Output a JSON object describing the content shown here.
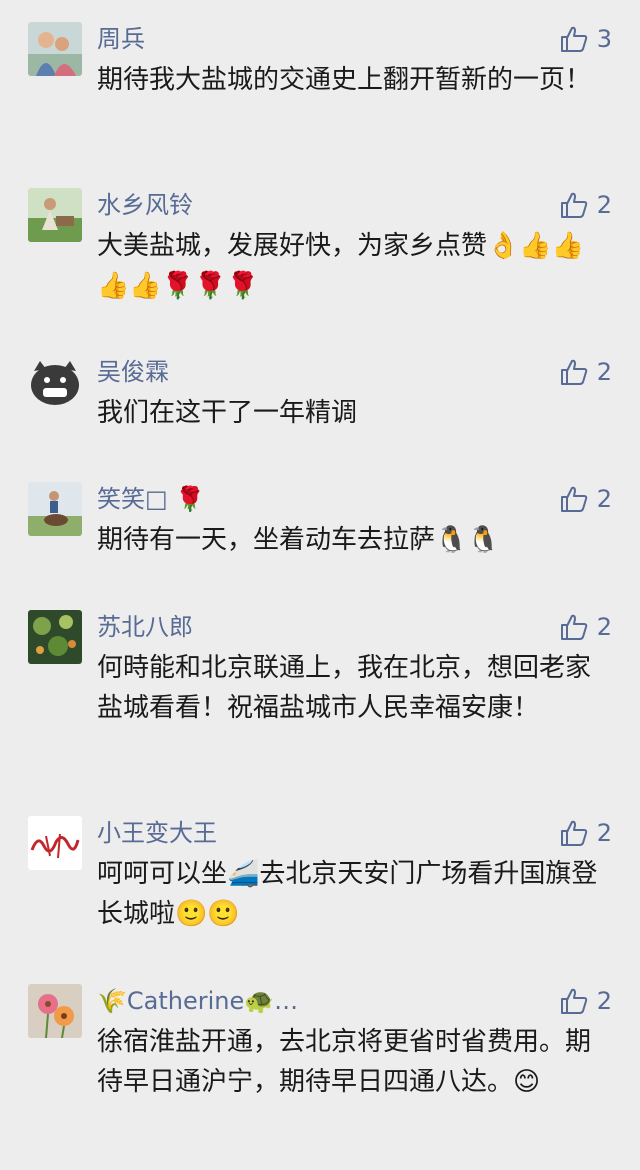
{
  "comments": [
    {
      "name": "周兵",
      "text": "期待我大盐城的交通史上翻开暂新的一页！",
      "likes": "3",
      "avatar": "avatar-photo-family"
    },
    {
      "name": "水乡风铃",
      "text": "大美盐城，发展好快，为家乡点赞👌👍👍👍👍🌹🌹🌹",
      "likes": "2",
      "avatar": "avatar-photo-field"
    },
    {
      "name": "吴俊霖",
      "text": "我们在这干了一年精调",
      "likes": "2",
      "avatar": "avatar-cartoon-pig"
    },
    {
      "name": "笑笑□ 🌹",
      "text": "期待有一天，坐着动车去拉萨🐧🐧",
      "likes": "2",
      "avatar": "avatar-photo-rider"
    },
    {
      "name": "苏北八郎",
      "text": "何時能和北京联通上，我在北京，想回老家盐城看看！祝福盐城市人民幸福安康！",
      "likes": "2",
      "avatar": "avatar-photo-flowers"
    },
    {
      "name": "小王变大王",
      "text": "呵呵可以坐🚄去北京天安门广场看升国旗登长城啦🙂🙂",
      "likes": "2",
      "avatar": "avatar-red-signature"
    },
    {
      "name": "🌾Catherine🐢…",
      "text": "徐宿淮盐开通，去北京将更省时省费用。期待早日通沪宁，期待早日四通八达。😊",
      "likes": "2",
      "avatar": "avatar-photo-gerbera"
    }
  ],
  "colors": {
    "background": "#ededed",
    "name": "#576b95",
    "text": "#1a1a1a",
    "like_icon": "#576b95"
  },
  "icons": {
    "like": "thumbs-up-outline-icon"
  }
}
